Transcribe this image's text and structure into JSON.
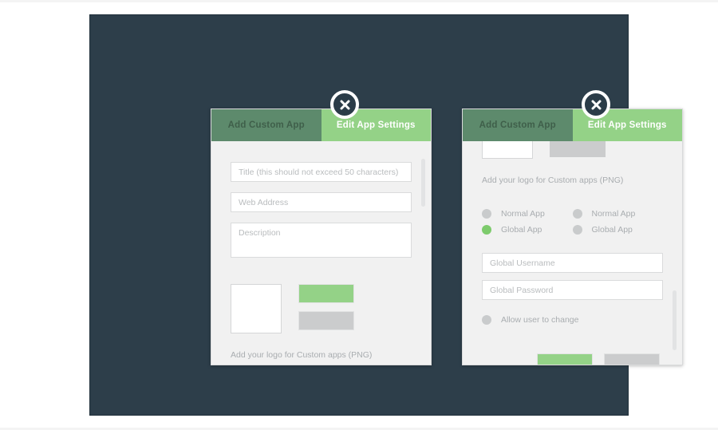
{
  "stage": {
    "background_color": "#2d3e4a"
  },
  "theme": {
    "accent_green": "#94d287",
    "tab_inactive_green": "#5d8a6c",
    "panel_background": "#f1f1f1",
    "grey_button": "#cbcccd",
    "placeholder_text": "#b9bcbe",
    "dark_navy": "#2d3e4a"
  },
  "modals": [
    {
      "id": "add-custom-app-modal",
      "tabs": [
        {
          "label": "Add Custom App",
          "active": false
        },
        {
          "label": "Edit App Settings",
          "active": true
        }
      ],
      "close_icon": "close-x-icon",
      "fields": [
        {
          "name": "title-field",
          "placeholder": "Title (this should not exceed 50 characters)",
          "value": ""
        },
        {
          "name": "web-address-field",
          "placeholder": "Web Address",
          "value": ""
        },
        {
          "name": "description-field",
          "placeholder": "Description",
          "value": ""
        }
      ],
      "logo_box_label": "",
      "buttons": [
        {
          "name": "primary-button",
          "label": "",
          "color": "#94d287"
        },
        {
          "name": "secondary-button",
          "label": "",
          "color": "#cbcccd"
        }
      ],
      "helper_text": "Add your logo for Custom apps (PNG)"
    },
    {
      "id": "edit-app-settings-modal",
      "tabs": [
        {
          "label": "Add Custom App",
          "active": false
        },
        {
          "label": "Edit App Settings",
          "active": true
        }
      ],
      "close_icon": "close-x-icon",
      "helper_text": "Add your logo for Custom apps (PNG)",
      "radio_groups": [
        {
          "name": "app-scope-group-left",
          "options": [
            {
              "label": "Normal App",
              "selected": false
            },
            {
              "label": "Global App",
              "selected": true
            }
          ]
        },
        {
          "name": "app-scope-group-right",
          "options": [
            {
              "label": "Normal App",
              "selected": false
            },
            {
              "label": "Global App",
              "selected": false
            }
          ]
        }
      ],
      "fields": [
        {
          "name": "global-username-field",
          "placeholder": "Global Username",
          "value": ""
        },
        {
          "name": "global-password-field",
          "placeholder": "Global Password",
          "value": ""
        }
      ],
      "allow_user_toggle": {
        "label": "Allow user to change",
        "selected": false
      },
      "buttons": [
        {
          "name": "primary-button",
          "label": "",
          "color": "#94d287"
        },
        {
          "name": "secondary-button",
          "label": "",
          "color": "#cbcccd"
        }
      ]
    }
  ]
}
